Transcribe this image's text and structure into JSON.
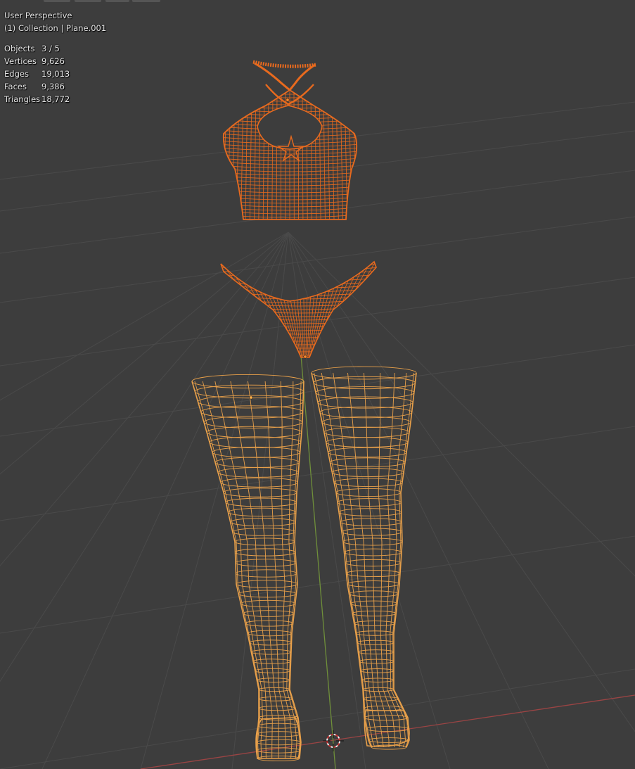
{
  "viewport": {
    "view_name": "User Perspective",
    "collection_label": "(1) Collection | Plane.001"
  },
  "stats": {
    "objects": {
      "label": "Objects",
      "value": "3 / 5"
    },
    "vertices": {
      "label": "Vertices",
      "value": "9,626"
    },
    "edges": {
      "label": "Edges",
      "value": "19,013"
    },
    "faces": {
      "label": "Faces",
      "value": "9,386"
    },
    "triangles": {
      "label": "Triangles",
      "value": "18,772"
    }
  },
  "colors": {
    "background": "#3d3d3d",
    "grid": "#4a4a4a",
    "x_axis": "#9a4444",
    "y_axis": "#6f8f3a",
    "active_wire": "#e8a04a",
    "selected_wire": "#e86a1e"
  },
  "objects": [
    {
      "name": "halter top",
      "state": "selected"
    },
    {
      "name": "bikini bottom",
      "state": "selected"
    },
    {
      "name": "stockings",
      "state": "active"
    }
  ],
  "icons": {
    "cursor": "3d-cursor-icon",
    "origin": "object-origin-icon"
  }
}
